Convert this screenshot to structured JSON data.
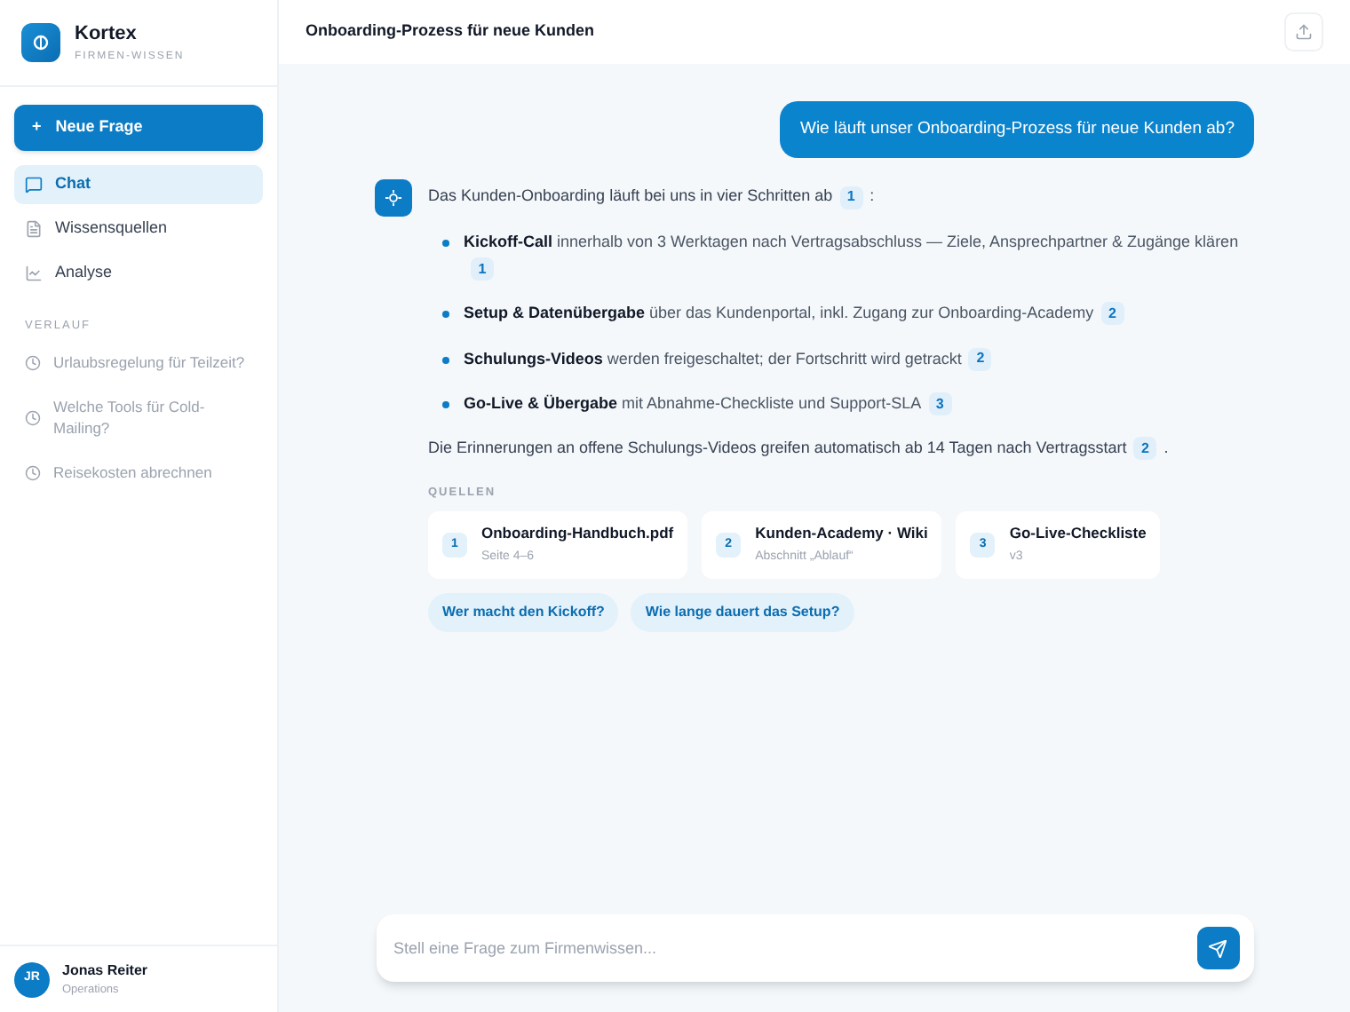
{
  "brand": {
    "name": "Kortex",
    "tagline": "FIRMEN-WISSEN"
  },
  "new_button": {
    "icon": "+",
    "label": "Neue Frage"
  },
  "nav": [
    {
      "label": "Chat",
      "kind": "chat",
      "selected": true
    },
    {
      "label": "Wissensquellen",
      "kind": "sources",
      "selected": false
    },
    {
      "label": "Analyse",
      "kind": "analytics",
      "selected": false
    }
  ],
  "history": {
    "title": "VERLAUF",
    "items": [
      "Urlaubsregelung für Teilzeit?",
      "Welche Tools für Cold-Mailing?",
      "Reisekosten abrechnen"
    ]
  },
  "user": {
    "initials": "JR",
    "name": "Jonas Reiter",
    "role": "Operations"
  },
  "header": {
    "title": "Onboarding-Prozess für neue Kunden"
  },
  "question": "Wie läuft unser Onboarding-Prozess für neue Kunden ab?",
  "answer": {
    "intro": {
      "text": "Das Kunden-Onboarding läuft bei uns in vier Schritten ab",
      "cite": "1",
      "suffix": ":"
    },
    "bullets": [
      {
        "text": "**Kickoff-Call** innerhalb von 3 Werktagen nach Vertragsabschluss — Ziele, Ansprechpartner & Zugänge klären",
        "cite": "1"
      },
      {
        "text": "**Setup & Datenübergabe** über das Kundenportal, inkl. Zugang zur Onboarding-Academy",
        "cite": "2"
      },
      {
        "text": "**Schulungs-Videos** werden freigeschaltet; der Fortschritt wird getrackt",
        "cite": "2"
      },
      {
        "text": "**Go-Live & Übergabe** mit Abnahme-Checkliste und Support-SLA",
        "cite": "3"
      }
    ],
    "outro": {
      "text": "Die Erinnerungen an offene Schulungs-Videos greifen automatisch ab 14 Tagen nach Vertragsstart",
      "cite": "2",
      "suffix": "."
    },
    "sources_title": "QUELLEN",
    "sources": [
      {
        "num": "1",
        "title": "Onboarding-Handbuch.pdf",
        "detail": "Seite 4–6"
      },
      {
        "num": "2",
        "title": "Kunden-Academy · Wiki",
        "detail": "Abschnitt „Ablauf“"
      },
      {
        "num": "3",
        "title": "Go-Live-Checkliste",
        "detail": "v3"
      }
    ],
    "suggestions": [
      "Wer macht den Kickoff?",
      "Wie lange dauert das Setup?"
    ]
  },
  "composer": {
    "placeholder": "Stell eine Frage zum Firmenwissen..."
  }
}
